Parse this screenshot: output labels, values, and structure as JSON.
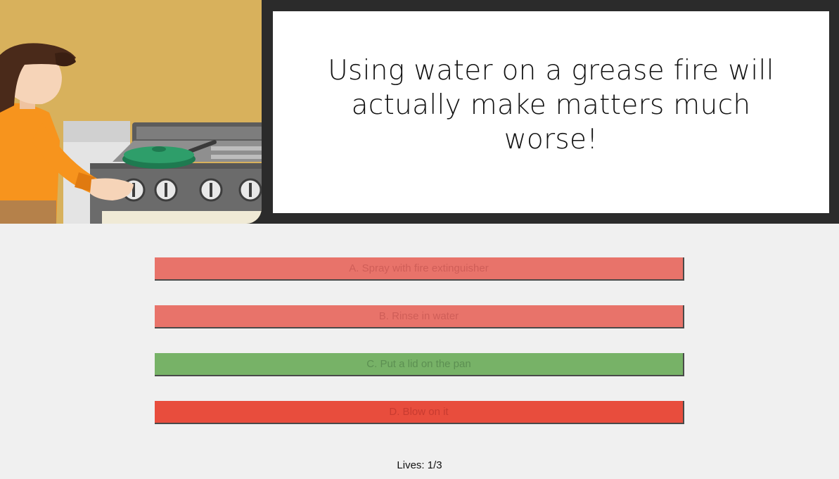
{
  "illustration": {
    "icon": "woman-cooking-at-stove-icon",
    "colors": {
      "wall": "#d8b15c",
      "shirt": "#f7941d",
      "pan": "#2e9e6a",
      "stove": "#6b6b6b"
    }
  },
  "message": "Using water on a grease fire will actually make matters much worse!",
  "answers": [
    {
      "label": "A. Spray with fire extinguisher",
      "state": "wrong",
      "color": "#e8736a"
    },
    {
      "label": "B. Rinse in water",
      "state": "wrong",
      "color": "#e8736a"
    },
    {
      "label": "C. Put a lid on the pan",
      "state": "correct",
      "color": "#77b267"
    },
    {
      "label": "D. Blow on it",
      "state": "selected-wrong",
      "color": "#e84d3d"
    }
  ],
  "lives_text": "Lives: 1/3"
}
